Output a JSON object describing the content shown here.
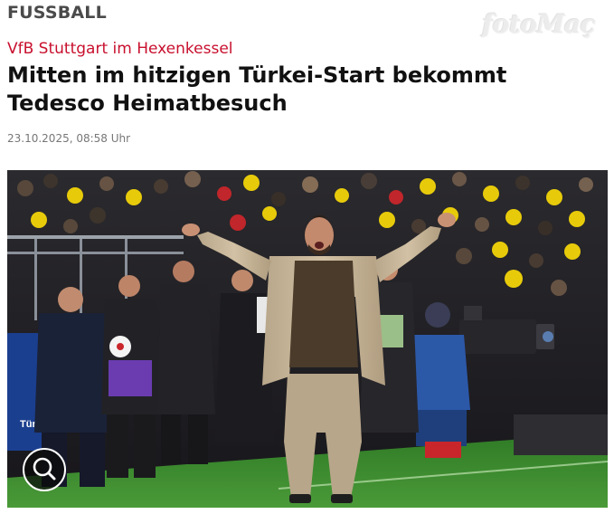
{
  "article": {
    "category": "FUSSBALL",
    "brand_watermark": "fotoMaç",
    "kicker": "VfB Stuttgart im Hexenkessel",
    "headline": "Mitten im hitzigen Türkei-Start bekommt Tedesco Heimatbesuch",
    "date": "23.10.2025, 08:58 Uhr"
  },
  "photo": {
    "banner_text": "Türk"
  },
  "zoom": {
    "icon": "magnifier-icon"
  },
  "colors": {
    "kicker": "#c8102e",
    "category": "#4a4a4a",
    "headline": "#111111",
    "date": "#777777",
    "pitch": "#3d8b2f",
    "crowd_accent": "#f2d40a"
  }
}
